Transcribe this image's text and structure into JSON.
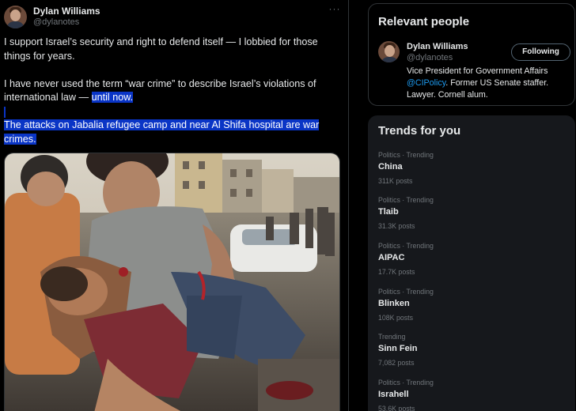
{
  "tweet": {
    "author_name": "Dylan Williams",
    "author_handle": "@dylanotes",
    "more_label": "···",
    "paragraph1": "I support Israel’s security and right to defend itself — I lobbied for those things for years.",
    "paragraph2_plain": "I have never used the term “war crime” to describe Israel’s violations of international law — ",
    "paragraph2_selected": "until now.",
    "paragraph3_selected": "The attacks on Jabalia refugee camp and near Al Shifa hospital are war crimes."
  },
  "relevant_people": {
    "title": "Relevant people",
    "person": {
      "name": "Dylan Williams",
      "handle": "@dylanotes",
      "follow_label": "Following",
      "bio_1": "Vice President for Government Affairs ",
      "bio_link": "@CIPolicy",
      "bio_2": ". Former US Senate staffer. Lawyer. Cornell alum."
    }
  },
  "trends": {
    "title": "Trends for you",
    "more_label": "···",
    "items": [
      {
        "meta": "Politics · Trending",
        "name": "China",
        "posts": "311K posts"
      },
      {
        "meta": "Politics · Trending",
        "name": "Tlaib",
        "posts": "31.3K posts"
      },
      {
        "meta": "Politics · Trending",
        "name": "AIPAC",
        "posts": "17.7K posts"
      },
      {
        "meta": "Politics · Trending",
        "name": "Blinken",
        "posts": "108K posts"
      },
      {
        "meta": "Trending",
        "name": "Sinn Fein",
        "posts": "7,082 posts"
      },
      {
        "meta": "Politics · Trending",
        "name": "Israhell",
        "posts": "53.6K posts"
      }
    ]
  },
  "colors": {
    "background": "#000000",
    "selection": "#0a35c6",
    "link": "#1d9bf0",
    "secondary_text": "#71767b",
    "card_background": "#16181c"
  }
}
